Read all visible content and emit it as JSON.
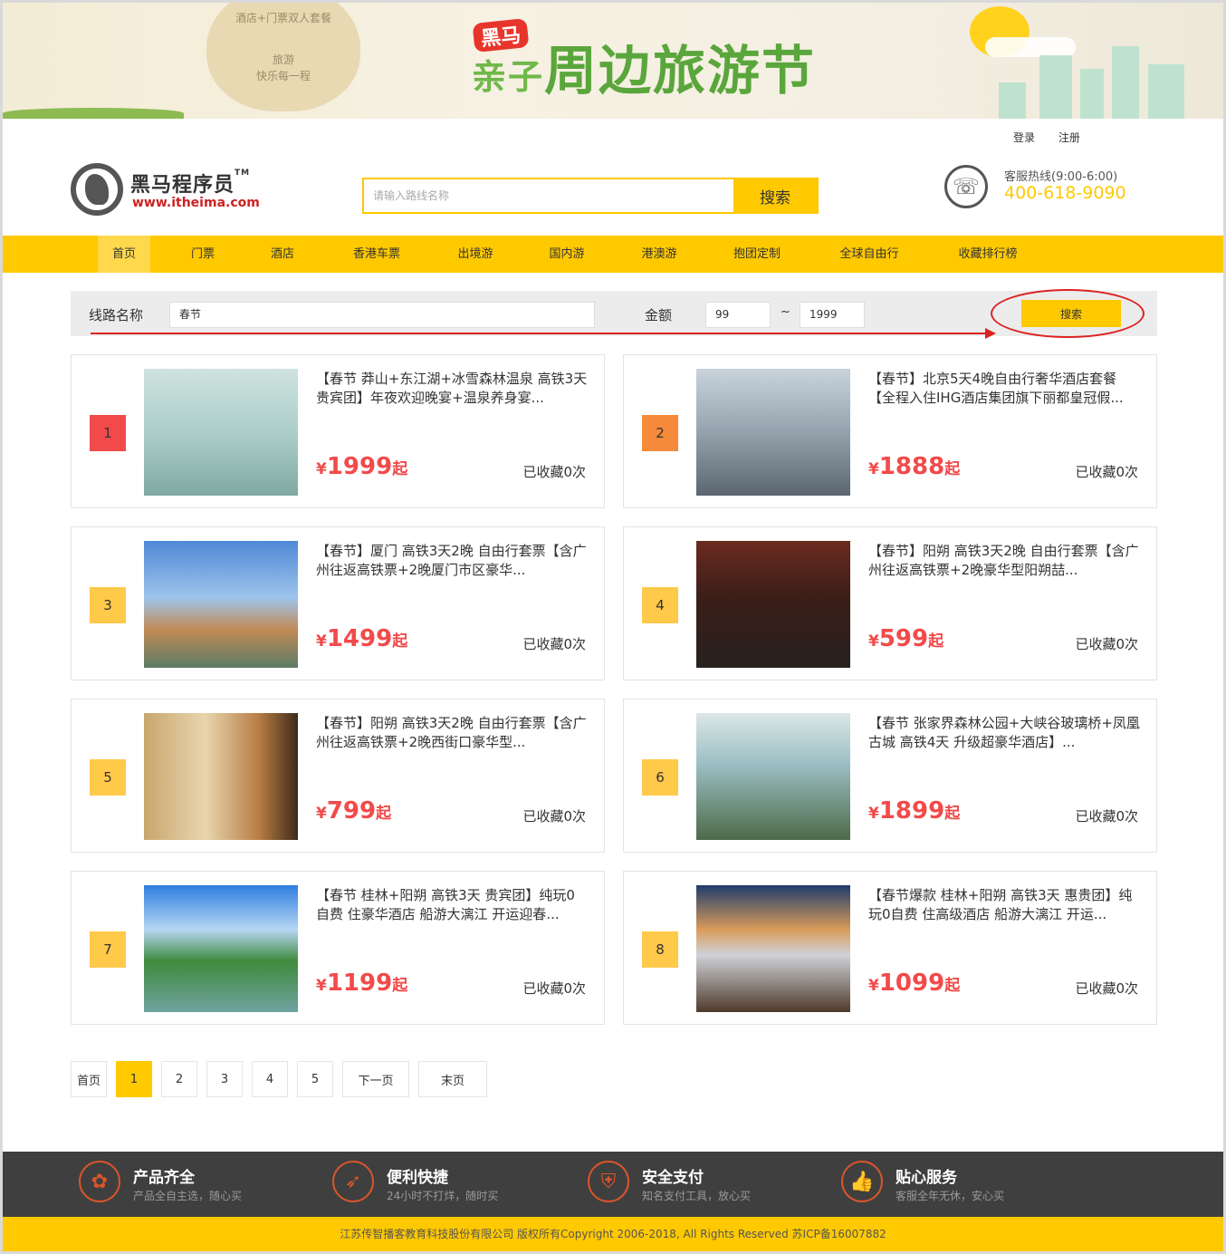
{
  "banner": {
    "bag_lines": [
      "酒店+门票双人套餐",
      "旅游",
      "快乐每一程"
    ],
    "badge": "黑马",
    "title_small": "亲子",
    "title_main": "周边旅游节"
  },
  "toplinks": {
    "login": "登录",
    "register": "注册"
  },
  "logo": {
    "cn": "黑马程序员",
    "tm": "TM",
    "en": "www.itheima.com"
  },
  "search": {
    "placeholder": "请输入路线名称",
    "button": "搜索"
  },
  "hotline": {
    "label": "客服热线(9:00-6:00)",
    "number": "400-618-9090",
    "icon": "phone-icon"
  },
  "nav": [
    {
      "label": "首页",
      "active": true
    },
    {
      "label": "门票"
    },
    {
      "label": "酒店"
    },
    {
      "label": "香港车票"
    },
    {
      "label": "出境游"
    },
    {
      "label": "国内游"
    },
    {
      "label": "港澳游"
    },
    {
      "label": "抱团定制"
    },
    {
      "label": "全球自由行"
    },
    {
      "label": "收藏排行榜"
    }
  ],
  "filter": {
    "route_label": "线路名称",
    "route_value": "春节",
    "amount_label": "金额",
    "min": "99",
    "tilde": "~",
    "max": "1999",
    "button": "搜索"
  },
  "cards": [
    {
      "rank": "1",
      "title": "【春节 莽山+东江湖+冰雪森林温泉 高铁3天 贵宾团】年夜欢迎晚宴+温泉养身宴...",
      "price": "1999",
      "fav": "已收藏0次",
      "rank_color": "#f24a4a",
      "img": "lake-boats"
    },
    {
      "rank": "2",
      "title": "【春节】北京5天4晚自由行奢华酒店套餐【全程入住IHG酒店集团旗下丽都皇冠假...",
      "price": "1888",
      "fav": "已收藏0次",
      "rank_color": "#f58a3a",
      "img": "stadium"
    },
    {
      "rank": "3",
      "title": "【春节】厦门 高铁3天2晚 自由行套票【含广州往返高铁票+2晚厦门市区豪华...",
      "price": "1499",
      "fav": "已收藏0次",
      "rank_color": "#ffc94a",
      "img": "statue"
    },
    {
      "rank": "4",
      "title": "【春节】阳朔 高铁3天2晚 自由行套票【含广州往返高铁票+2晚豪华型阳朔喆...",
      "price": "599",
      "fav": "已收藏0次",
      "rank_color": "#ffc94a",
      "img": "hotel"
    },
    {
      "rank": "5",
      "title": "【春节】阳朔 高铁3天2晚 自由行套票【含广州往返高铁票+2晚西街口豪华型...",
      "price": "799",
      "fav": "已收藏0次",
      "rank_color": "#ffc94a",
      "img": "lobby"
    },
    {
      "rank": "6",
      "title": "【春节 张家界森林公园+大峡谷玻璃桥+凤凰古城 高铁4天 升级超豪华酒店】...",
      "price": "1899",
      "fav": "已收藏0次",
      "rank_color": "#ffc94a",
      "img": "bridge"
    },
    {
      "rank": "7",
      "title": "【春节 桂林+阳朔 高铁3天 贵宾团】纯玩0自费 住豪华酒店 船游大漓江 开运迎春...",
      "price": "1199",
      "fav": "已收藏0次",
      "rank_color": "#ffc94a",
      "img": "river"
    },
    {
      "rank": "8",
      "title": "【春节爆款 桂林+阳朔 高铁3天 惠贵团】纯玩0自费 住高级酒店 船游大漓江 开运...",
      "price": "1099",
      "fav": "已收藏0次",
      "rank_color": "#ffc94a",
      "img": "sunset"
    }
  ],
  "price_currency": "¥",
  "price_suffix": "起",
  "pager": [
    {
      "label": "首页"
    },
    {
      "label": "1",
      "active": true
    },
    {
      "label": "2"
    },
    {
      "label": "3"
    },
    {
      "label": "4"
    },
    {
      "label": "5"
    },
    {
      "label": "下一页"
    },
    {
      "label": "末页"
    }
  ],
  "features": [
    {
      "title": "产品齐全",
      "desc": "产品全自主选，随心买",
      "icon": "grid-icon"
    },
    {
      "title": "便利快捷",
      "desc": "24小时不打烊，随时买",
      "icon": "rocket-icon"
    },
    {
      "title": "安全支付",
      "desc": "知名支付工具，放心买",
      "icon": "shield-icon"
    },
    {
      "title": "贴心服务",
      "desc": "客服全年无休，安心买",
      "icon": "thumbs-up-icon"
    }
  ],
  "copyright": "江苏传智播客教育科技股份有限公司 版权所有Copyright 2006-2018, All Rights Reserved 苏ICP备16007882",
  "colors": {
    "accent": "#ffc900",
    "price": "#f24a4a",
    "footer": "#3f3f3f"
  }
}
